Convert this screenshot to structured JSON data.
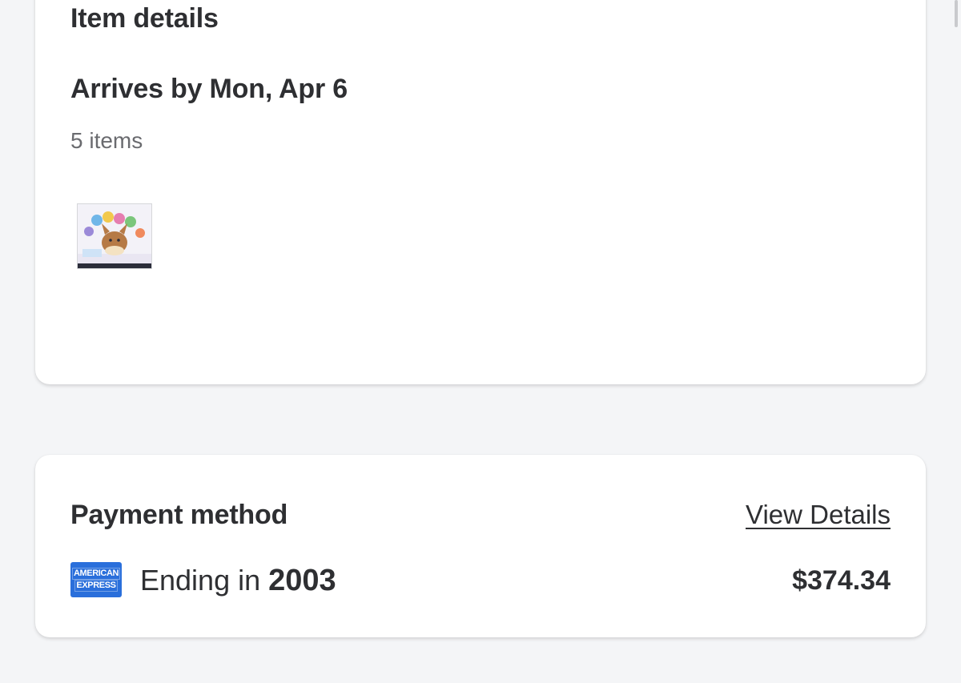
{
  "item_details": {
    "title": "Item details",
    "arrival": "Arrives by Mon, Apr 6",
    "count": "5 items",
    "thumbnail_icon": "product-box-image"
  },
  "payment": {
    "title": "Payment method",
    "view_details_label": "View Details",
    "card_brand_line1": "AMERICAN",
    "card_brand_line2": "EXPRESS",
    "card_brand_icon": "amex-card-icon",
    "ending_prefix": "Ending in",
    "ending_digits": "2003",
    "amount": "$374.34"
  },
  "colors": {
    "background": "#f4f5f7",
    "card": "#ffffff",
    "text": "#2e2f32",
    "muted": "#6a6b6f",
    "amex_blue": "#2a6fdb"
  }
}
